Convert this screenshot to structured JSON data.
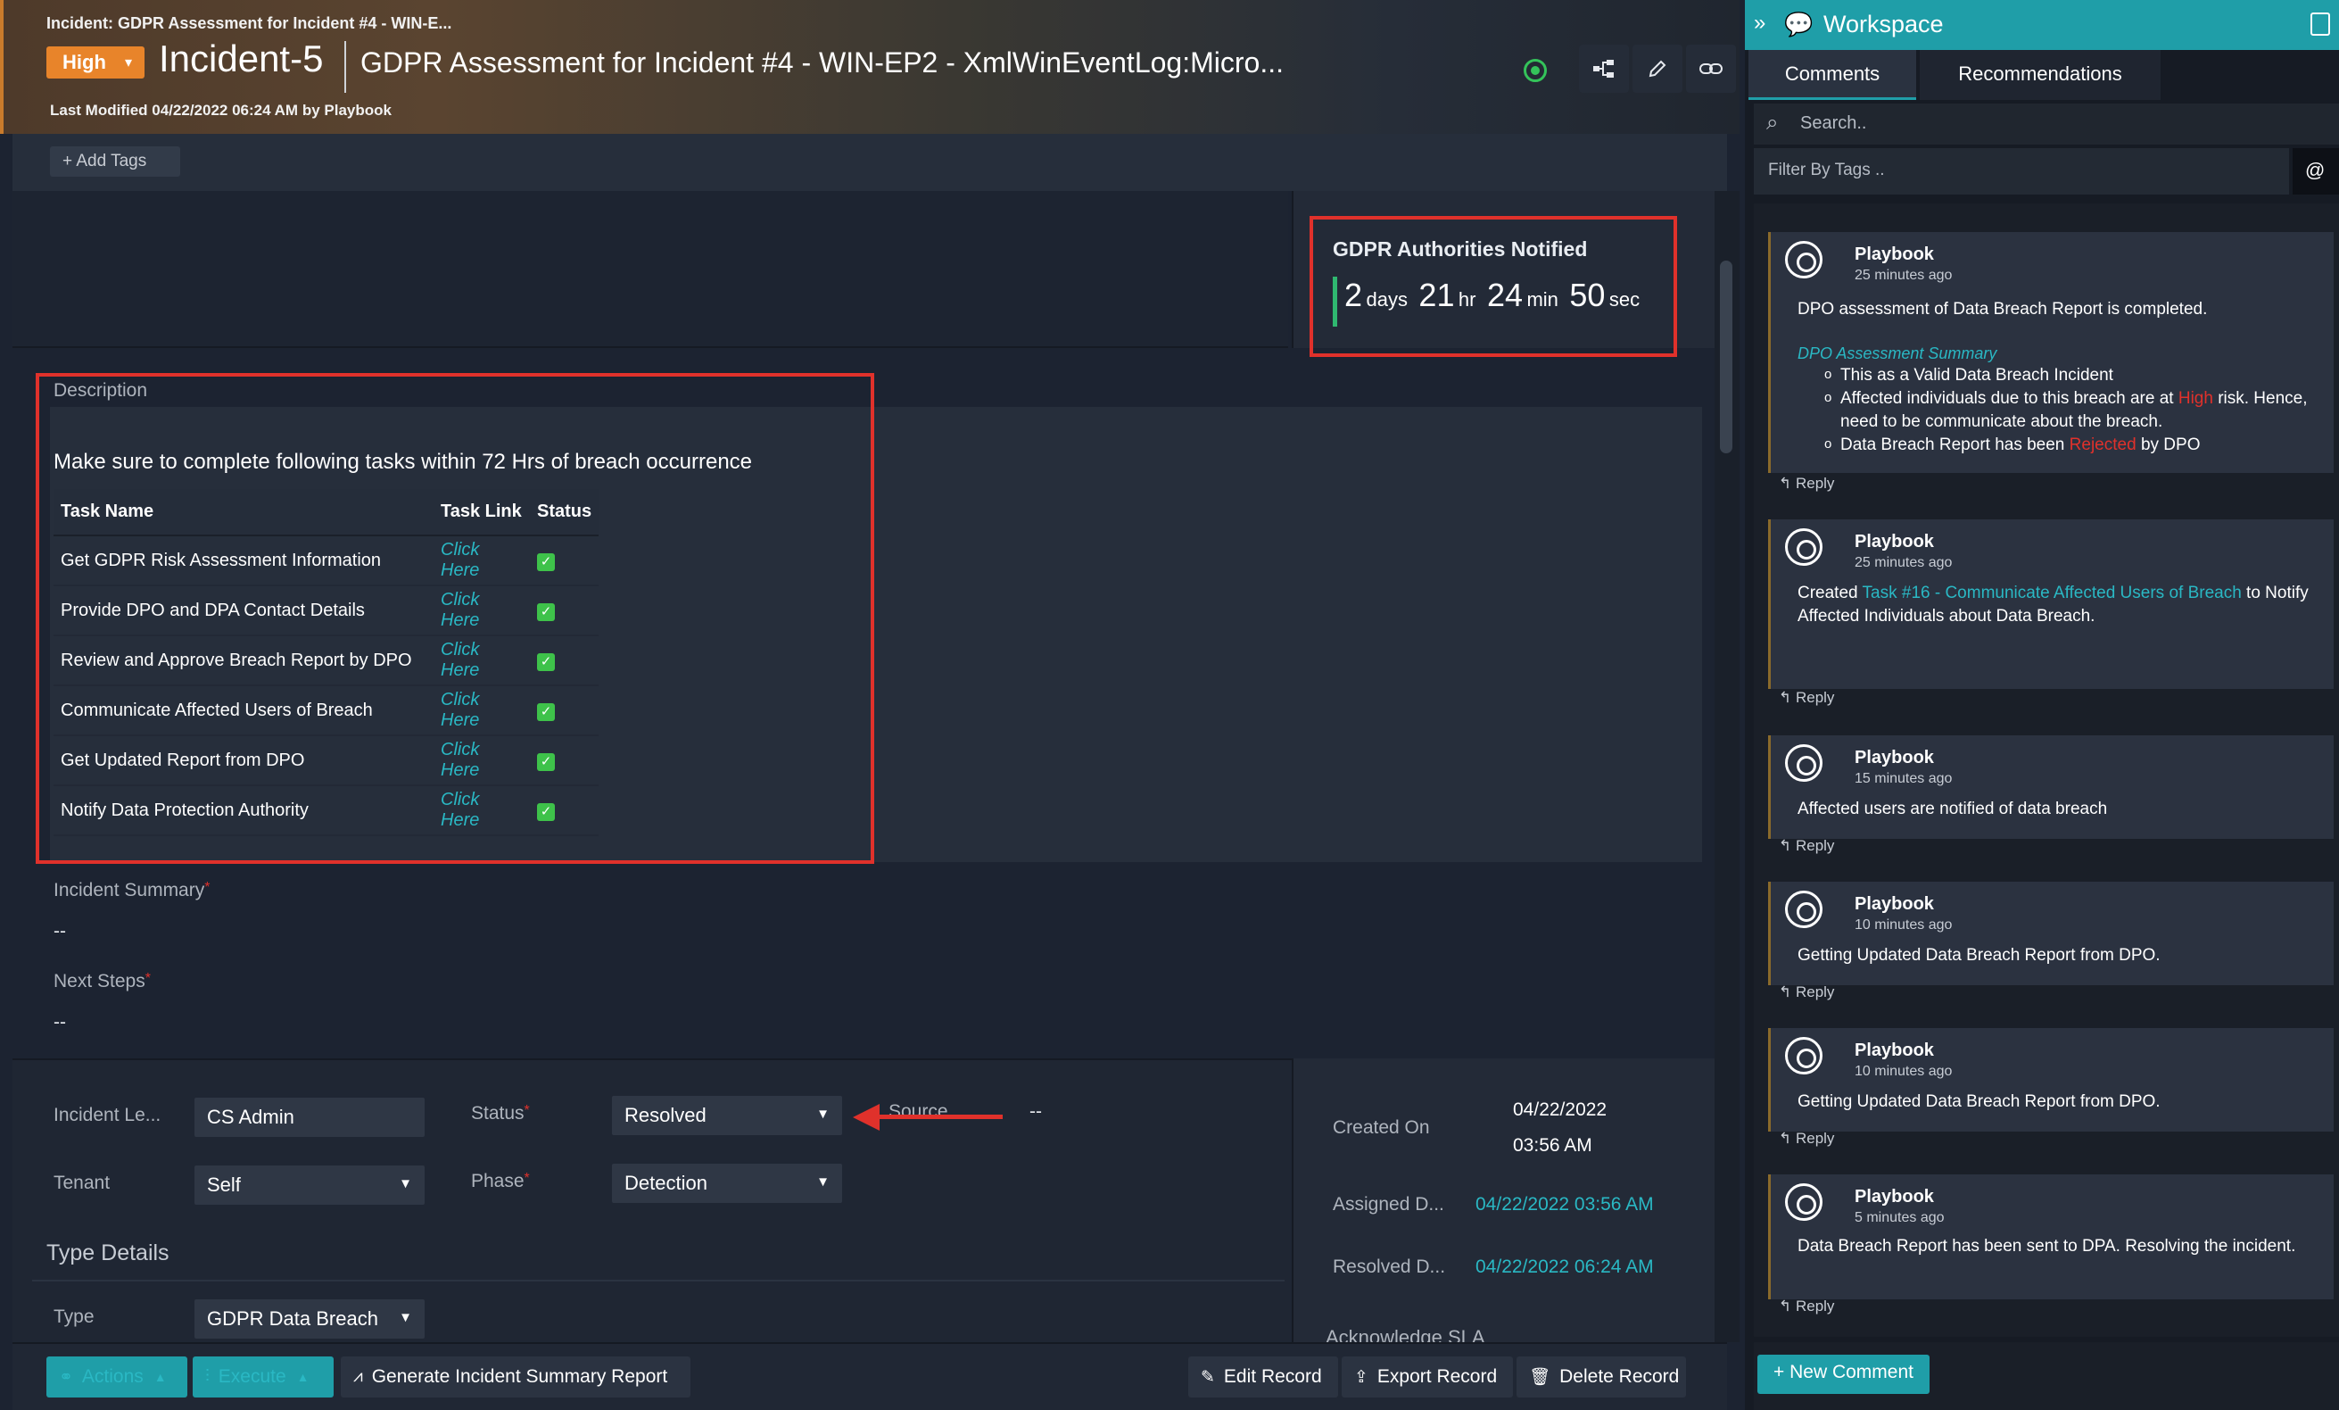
{
  "header": {
    "breadcrumb": "Incident: GDPR Assessment for Incident #4 - WIN-E...",
    "severity": "High",
    "incident_id": "Incident-5",
    "title": "GDPR Assessment for Incident #4 - WIN-EP2 - XmlWinEventLog:Micro...",
    "last_modified": "Last Modified 04/22/2022 06:24 AM by Playbook",
    "icons": [
      "status-dot-icon",
      "playbook-tree-icon",
      "pencil-icon",
      "link-icon"
    ]
  },
  "tags": {
    "add_label": "+ Add Tags"
  },
  "sla": {
    "title": "GDPR Authorities Notified",
    "days": "2",
    "days_unit": "days",
    "hours": "21",
    "hours_unit": "hr",
    "minutes": "24",
    "minutes_unit": "min",
    "seconds": "50",
    "seconds_unit": "sec"
  },
  "description": {
    "label": "Description",
    "heading": "Make sure to complete following tasks within 72 Hrs of breach occurrence",
    "columns": [
      "Task Name",
      "Task Link",
      "Status"
    ],
    "rows": [
      {
        "name": "Get GDPR Risk Assessment Information",
        "link": "Click Here"
      },
      {
        "name": "Provide DPO and DPA Contact Details",
        "link": "Click Here"
      },
      {
        "name": "Review and Approve Breach Report by DPO",
        "link": "Click Here"
      },
      {
        "name": "Communicate Affected Users of Breach",
        "link": "Click Here"
      },
      {
        "name": "Get Updated Report from DPO",
        "link": "Click Here"
      },
      {
        "name": "Notify Data Protection Authority",
        "link": "Click Here"
      }
    ],
    "status_icon": "checkmark-icon"
  },
  "fields": {
    "incident_summary_label": "Incident Summary",
    "incident_summary_value": "--",
    "next_steps_label": "Next Steps",
    "next_steps_value": "--",
    "incident_lead_label": "Incident Le...",
    "incident_lead_value": "CS Admin",
    "status_label": "Status",
    "status_value": "Resolved",
    "source_label": "Source",
    "source_value": "--",
    "tenant_label": "Tenant",
    "tenant_value": "Self",
    "phase_label": "Phase",
    "phase_value": "Detection",
    "type_details_title": "Type Details",
    "type_label": "Type",
    "type_value": "GDPR Data Breach",
    "required_mark": "*"
  },
  "dates": {
    "created_label": "Created On",
    "created_date": "04/22/2022",
    "created_time": "03:56 AM",
    "assigned_label": "Assigned D...",
    "assigned_value": "04/22/2022 03:56 AM",
    "resolved_label": "Resolved D...",
    "resolved_value": "04/22/2022 06:24 AM",
    "ack_sla_label": "Acknowledge SLA"
  },
  "footer": {
    "actions": "Actions",
    "execute": "Execute",
    "generate_report": "Generate Incident Summary Report",
    "edit": "Edit Record",
    "export": "Export Record",
    "delete": "Delete Record"
  },
  "workspace": {
    "title": "Workspace",
    "tabs": [
      "Comments",
      "Recommendations"
    ],
    "search_placeholder": "Search..",
    "filter_placeholder": "Filter By Tags ..",
    "at_symbol": "@",
    "reply_label": "Reply",
    "new_comment": "+ New Comment",
    "comments": [
      {
        "author": "Playbook",
        "time": "25 minutes ago",
        "body": "DPO assessment of Data Breach Report is completed.",
        "subheading": "DPO Assessment Summary",
        "bullet1": "This as a Valid Data Breach Incident",
        "bullet2_a": "Affected individuals due to this breach are at ",
        "bullet2_red": "High",
        "bullet2_b": " risk. Hence, need to be communicate about the breach.",
        "bullet3_a": "Data Breach Report has been ",
        "bullet3_red": "Rejected",
        "bullet3_b": " by DPO"
      },
      {
        "author": "Playbook",
        "time": "25 minutes ago",
        "body_a": "Created ",
        "body_link": "Task #16 - Communicate Affected Users of Breach",
        "body_b": " to Notify Affected Individuals about Data Breach."
      },
      {
        "author": "Playbook",
        "time": "15 minutes ago",
        "body": "Affected users are notified of data breach"
      },
      {
        "author": "Playbook",
        "time": "10 minutes ago",
        "body": "Getting Updated Data Breach Report from DPO."
      },
      {
        "author": "Playbook",
        "time": "10 minutes ago",
        "body": "Getting Updated Data Breach Report from DPO."
      },
      {
        "author": "Playbook",
        "time": "5 minutes ago",
        "body": "Data Breach Report has been sent to DPA. Resolving the incident."
      }
    ]
  }
}
